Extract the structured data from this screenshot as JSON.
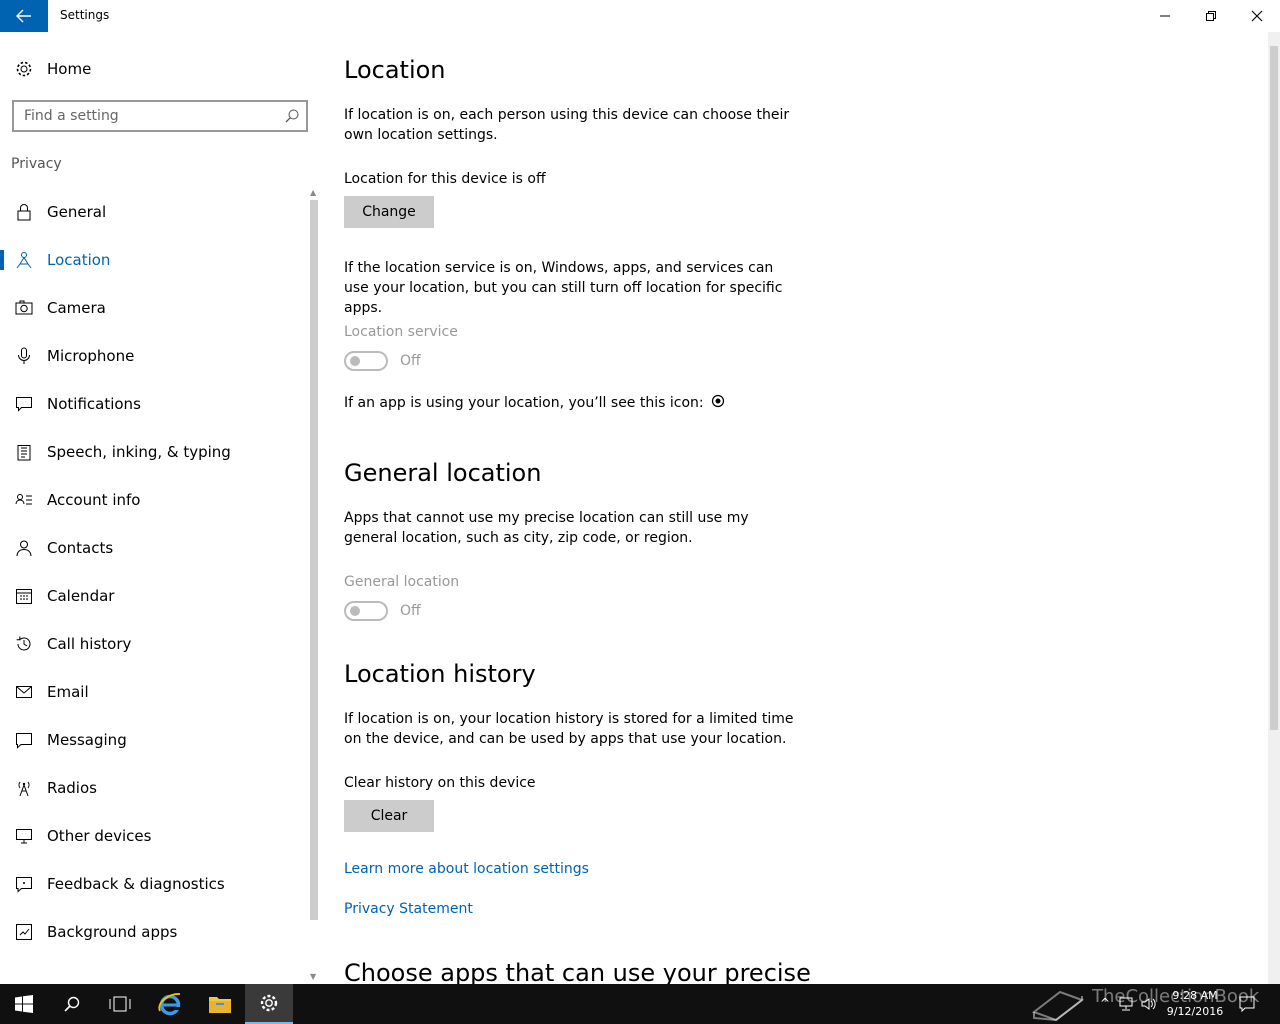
{
  "window": {
    "title": "Settings"
  },
  "sidebar": {
    "home_label": "Home",
    "search_placeholder": "Find a setting",
    "section_label": "Privacy",
    "items": [
      {
        "label": "General",
        "icon": "lock-icon"
      },
      {
        "label": "Location",
        "icon": "location-person-icon",
        "active": true
      },
      {
        "label": "Camera",
        "icon": "camera-icon"
      },
      {
        "label": "Microphone",
        "icon": "microphone-icon"
      },
      {
        "label": "Notifications",
        "icon": "notification-icon"
      },
      {
        "label": "Speech, inking, & typing",
        "icon": "clipboard-icon"
      },
      {
        "label": "Account info",
        "icon": "account-info-icon"
      },
      {
        "label": "Contacts",
        "icon": "contacts-icon"
      },
      {
        "label": "Calendar",
        "icon": "calendar-icon"
      },
      {
        "label": "Call history",
        "icon": "history-icon"
      },
      {
        "label": "Email",
        "icon": "mail-icon"
      },
      {
        "label": "Messaging",
        "icon": "message-icon"
      },
      {
        "label": "Radios",
        "icon": "radio-tower-icon"
      },
      {
        "label": "Other devices",
        "icon": "devices-icon"
      },
      {
        "label": "Feedback & diagnostics",
        "icon": "feedback-icon"
      },
      {
        "label": "Background apps",
        "icon": "background-apps-icon"
      }
    ]
  },
  "main": {
    "location_heading": "Location",
    "location_desc": "If location is on, each person using this device can choose their own location settings.",
    "device_status": "Location for this device is off",
    "change_button": "Change",
    "service_desc": "If the location service is on, Windows, apps, and services can use your location, but you can still turn off location for specific apps.",
    "service_label": "Location service",
    "service_state": "Off",
    "icon_notice": "If an app is using your location, you’ll see this icon:",
    "general_heading": "General location",
    "general_desc": "Apps that cannot use my precise location can still use my general location, such as city, zip code, or region.",
    "general_label": "General location",
    "general_state": "Off",
    "history_heading": "Location history",
    "history_desc": "If location is on, your location history is stored for a limited time on the device, and can be used by apps that use your location.",
    "clear_label": "Clear history on this device",
    "clear_button": "Clear",
    "learn_more_link": "Learn more about location settings",
    "privacy_link": "Privacy Statement",
    "choose_apps_heading": "Choose apps that can use your precise"
  },
  "taskbar": {
    "time": "9:28 AM",
    "date": "9/12/2016",
    "watermark": "TheCollectionBook"
  },
  "colors": {
    "accent": "#0063b1",
    "taskbar": "#101010",
    "button_bg": "#cccccc",
    "disabled_text": "#999999"
  }
}
